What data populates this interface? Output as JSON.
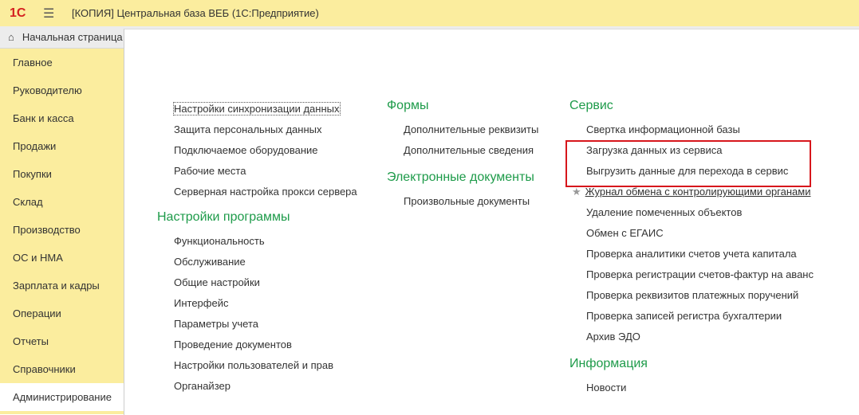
{
  "window": {
    "logo": "1С",
    "title": "[КОПИЯ] Центральная база ВЕБ  (1С:Предприятие)"
  },
  "tabs": {
    "home": "Начальная страница"
  },
  "sidebar": {
    "items": [
      "Главное",
      "Руководителю",
      "Банк и касса",
      "Продажи",
      "Покупки",
      "Склад",
      "Производство",
      "ОС и НМА",
      "Зарплата и кадры",
      "Операции",
      "Отчеты",
      "Справочники",
      "Администрирование"
    ],
    "active": "Администрирование"
  },
  "col1": {
    "links_top": [
      "Настройки синхронизации данных",
      "Защита персональных данных",
      "Подключаемое оборудование",
      "Рабочие места",
      "Серверная настройка прокси сервера"
    ],
    "heading": "Настройки программы",
    "links": [
      "Функциональность",
      "Обслуживание",
      "Общие настройки",
      "Интерфейс",
      "Параметры учета",
      "Проведение документов",
      "Настройки пользователей и прав",
      "Органайзер"
    ]
  },
  "col2": {
    "heading1": "Формы",
    "links1": [
      "Дополнительные реквизиты",
      "Дополнительные сведения"
    ],
    "heading2": "Электронные документы",
    "links2": [
      "Произвольные документы"
    ]
  },
  "col3": {
    "heading": "Сервис",
    "links": [
      "Свертка информационной базы",
      "Загрузка данных из сервиса",
      "Выгрузить данные для перехода в сервис",
      "Журнал обмена с контролирующими органами",
      "Удаление помеченных объектов",
      "Обмен с ЕГАИС",
      "Проверка аналитики счетов учета капитала",
      "Проверка регистрации счетов-фактур на аванс",
      "Проверка реквизитов платежных поручений",
      "Проверка записей регистра бухгалтерии",
      "Архив ЭДО"
    ],
    "heading2": "Информация",
    "links2": [
      "Новости"
    ]
  },
  "colors": {
    "accent": "#1e9b4a",
    "sidebar": "#FBED9E",
    "highlight": "#d7161c"
  }
}
